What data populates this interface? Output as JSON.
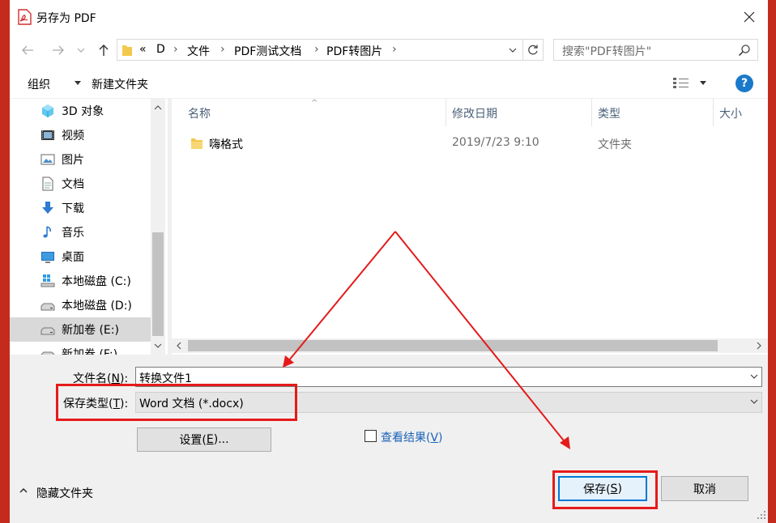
{
  "window": {
    "title": "另存为 PDF"
  },
  "address": {
    "items": [
      "«",
      "D",
      "文件",
      "PDF测试文档",
      "PDF转图片"
    ],
    "separators": [
      "›",
      "›",
      "›",
      "›"
    ]
  },
  "search": {
    "placeholder": "搜索\"PDF转图片\""
  },
  "toolbar": {
    "organize": "组织",
    "new_folder": "新建文件夹",
    "help": "?"
  },
  "nav_pane": {
    "items": [
      {
        "label": "3D 对象",
        "icon": "3d-objects-icon"
      },
      {
        "label": "视频",
        "icon": "video-icon"
      },
      {
        "label": "图片",
        "icon": "pictures-icon"
      },
      {
        "label": "文档",
        "icon": "documents-icon"
      },
      {
        "label": "下载",
        "icon": "download-icon"
      },
      {
        "label": "音乐",
        "icon": "music-icon"
      },
      {
        "label": "桌面",
        "icon": "desktop-icon"
      },
      {
        "label": "本地磁盘 (C:)",
        "icon": "windows-drive-icon"
      },
      {
        "label": "本地磁盘 (D:)",
        "icon": "drive-icon"
      },
      {
        "label": "新加卷 (E:)",
        "icon": "drive-icon",
        "selected": true
      },
      {
        "label": "新加卷 (F:)",
        "icon": "drive-icon"
      }
    ]
  },
  "file_list": {
    "columns": [
      "名称",
      "修改日期",
      "类型",
      "大小"
    ],
    "rows": [
      {
        "name": "嗨格式",
        "modified": "2019/7/23 9:10",
        "type": "文件夹",
        "size": ""
      }
    ]
  },
  "form": {
    "filename_label_text": "文件名(",
    "filename_label_key": "N",
    "filename_label_end": "):",
    "filename_value": "转换文件1",
    "filetype_label_text": "保存类型(",
    "filetype_label_key": "T",
    "filetype_label_end": "):",
    "filetype_value": "Word 文档 (*.docx)",
    "settings_text": "设置(",
    "settings_key": "E",
    "settings_end": ")...",
    "view_result_text": "查看结果(",
    "view_result_key": "V",
    "view_result_end": ")",
    "view_result_checked": false
  },
  "footer": {
    "hide_folders": "隐藏文件夹",
    "save_text": "保存(",
    "save_key": "S",
    "save_end": ")",
    "cancel": "取消"
  },
  "colors": {
    "annotation": "#e51a1a",
    "frame": "#c42b1c",
    "accent": "#0078d7"
  }
}
